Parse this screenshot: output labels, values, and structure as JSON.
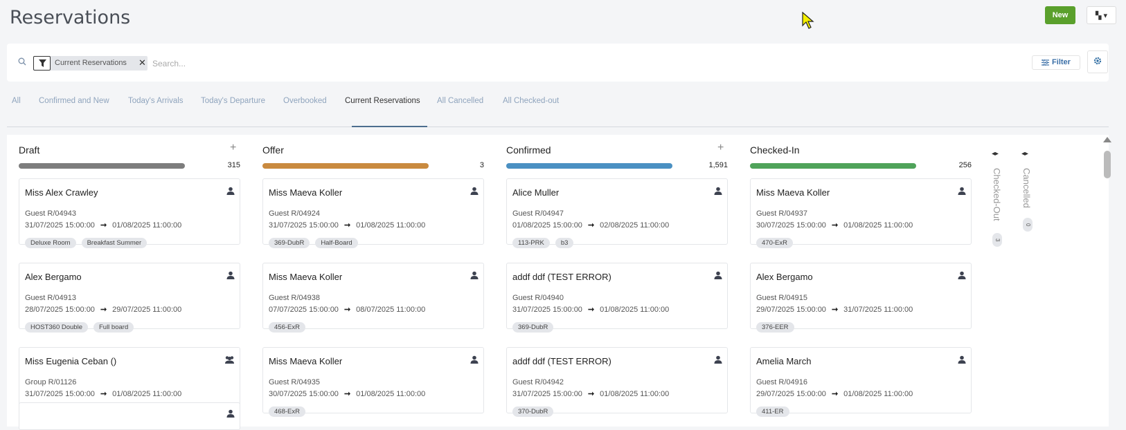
{
  "page": {
    "title": "Reservations"
  },
  "toolbar": {
    "new_label": "New",
    "view_toggle": "▚ ▾"
  },
  "search": {
    "placeholder": "Search...",
    "active_filter": "Current Reservations",
    "filter_label": "Filter"
  },
  "tabs": [
    {
      "label": "All"
    },
    {
      "label": "Confirmed and New"
    },
    {
      "label": "Today's Arrivals"
    },
    {
      "label": "Today's Departure"
    },
    {
      "label": "Overbooked"
    },
    {
      "label": "Current Reservations",
      "active": true
    },
    {
      "label": "All Cancelled"
    },
    {
      "label": "All Checked-out"
    }
  ],
  "columns": [
    {
      "title": "Draft",
      "count": "315",
      "color": "#7d7d7d",
      "has_add": true,
      "cards": [
        {
          "name": "Miss Alex Crawley",
          "icon": "person-icon",
          "ref": "Guest R/04943",
          "arrival": "31/07/2025 15:00:00",
          "departure": "01/08/2025 11:00:00",
          "tags": [
            "Deluxe Room",
            "Breakfast Summer"
          ]
        },
        {
          "name": "Alex Bergamo",
          "icon": "person-icon",
          "ref": "Guest R/04913",
          "arrival": "28/07/2025 15:00:00",
          "departure": "29/07/2025 11:00:00",
          "tags": [
            "HOST360 Double",
            "Full board"
          ]
        },
        {
          "name": "Miss Eugenia Ceban ()",
          "icon": "group-icon",
          "ref": "Group R/01126",
          "arrival": "31/07/2025 15:00:00",
          "departure": "01/08/2025 11:00:00",
          "tags": []
        }
      ]
    },
    {
      "title": "Offer",
      "count": "3",
      "color": "#c98a3f",
      "has_add": false,
      "cards": [
        {
          "name": "Miss Maeva Koller",
          "icon": "person-icon",
          "ref": "Guest R/04924",
          "arrival": "31/07/2025 15:00:00",
          "departure": "01/08/2025 11:00:00",
          "tags": [
            "369-DubR",
            "Half-Board"
          ]
        },
        {
          "name": "Miss Maeva Koller",
          "icon": "person-icon",
          "ref": "Guest R/04938",
          "arrival": "07/07/2025 15:00:00",
          "departure": "08/07/2025 11:00:00",
          "tags": [
            "456-ExR"
          ]
        },
        {
          "name": "Miss Maeva Koller",
          "icon": "person-icon",
          "ref": "Guest R/04935",
          "arrival": "30/07/2025 15:00:00",
          "departure": "01/08/2025 11:00:00",
          "tags": [
            "468-ExR"
          ]
        }
      ]
    },
    {
      "title": "Confirmed",
      "count": "1,591",
      "color": "#4a90c2",
      "has_add": true,
      "cards": [
        {
          "name": "Alice Muller",
          "icon": "person-icon",
          "ref": "Guest R/04947",
          "arrival": "01/08/2025 15:00:00",
          "departure": "02/08/2025 11:00:00",
          "tags": [
            "113-PRK",
            "b3"
          ]
        },
        {
          "name": "addf ddf (TEST ERROR)",
          "icon": "person-icon",
          "ref": "Guest R/04940",
          "arrival": "31/07/2025 15:00:00",
          "departure": "01/08/2025 11:00:00",
          "tags": [
            "369-DubR"
          ]
        },
        {
          "name": "addf ddf (TEST ERROR)",
          "icon": "person-icon",
          "ref": "Guest R/04942",
          "arrival": "31/07/2025 15:00:00",
          "departure": "01/08/2025 11:00:00",
          "tags": [
            "370-DubR"
          ]
        }
      ]
    },
    {
      "title": "Checked-In",
      "count": "256",
      "color": "#4fa35a",
      "has_add": false,
      "cards": [
        {
          "name": "Miss Maeva Koller",
          "icon": "person-icon",
          "ref": "Guest R/04937",
          "arrival": "30/07/2025 15:00:00",
          "departure": "01/08/2025 11:00:00",
          "tags": [
            "470-ExR"
          ]
        },
        {
          "name": "Alex Bergamo",
          "icon": "person-icon",
          "ref": "Guest R/04915",
          "arrival": "29/07/2025 15:00:00",
          "departure": "31/07/2025 11:00:00",
          "tags": [
            "376-EER"
          ]
        },
        {
          "name": "Amelia March",
          "icon": "person-icon",
          "ref": "Guest R/04916",
          "arrival": "29/07/2025 15:00:00",
          "departure": "01/08/2025 11:00:00",
          "tags": [
            "411-ER"
          ]
        }
      ]
    }
  ],
  "folded_columns": [
    {
      "label": "Checked-Out",
      "count": "3"
    },
    {
      "label": "Cancelled",
      "count": "0"
    }
  ]
}
